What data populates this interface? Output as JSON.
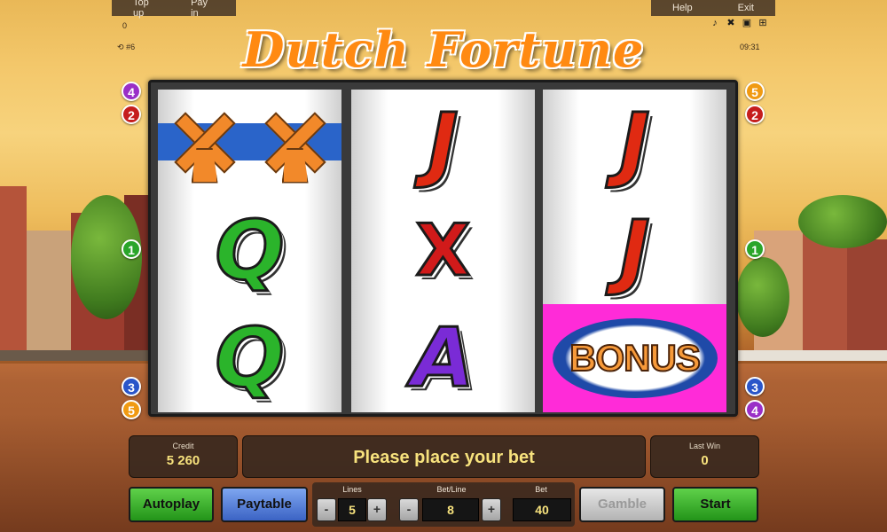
{
  "top_menu": {
    "top_up": "Top up",
    "pay_in": "Pay in",
    "help": "Help",
    "exit": "Exit"
  },
  "info": {
    "balance_small": "0",
    "session_id": "#6",
    "clock": "09:31"
  },
  "header_icons": [
    "music-icon",
    "sound-icon",
    "fullscreen-icon",
    "settings-icon"
  ],
  "title": "Dutch Fortune",
  "line_badges": {
    "left": [
      "4",
      "2",
      "1",
      "3",
      "5"
    ],
    "right": [
      "5",
      "2",
      "1",
      "3",
      "4"
    ]
  },
  "reels": [
    [
      "windmill",
      "Q",
      "Q"
    ],
    [
      "J",
      "X",
      "A"
    ],
    [
      "J",
      "J",
      "BONUS"
    ]
  ],
  "symbols": {
    "bonus": "BONUS",
    "q": "Q",
    "j": "J",
    "a": "A",
    "x": "X"
  },
  "credit": {
    "label": "Credit",
    "value": "5 260"
  },
  "message": "Please place your bet",
  "last_win": {
    "label": "Last Win",
    "value": "0"
  },
  "controls": {
    "autoplay": "Autoplay",
    "paytable": "Paytable",
    "lines_label": "Lines",
    "lines_value": "5",
    "bet_line_label": "Bet/Line",
    "bet_line_value": "8",
    "bet_label": "Bet",
    "bet_value": "40",
    "gamble": "Gamble",
    "start": "Start",
    "minus": "-",
    "plus": "+"
  },
  "colors": {
    "title": "#ff8a12",
    "button_green": "#2ea11f",
    "button_blue": "#4b72d1",
    "value_text": "#f7e27d",
    "bonus_bg": "#ff2bd8"
  }
}
